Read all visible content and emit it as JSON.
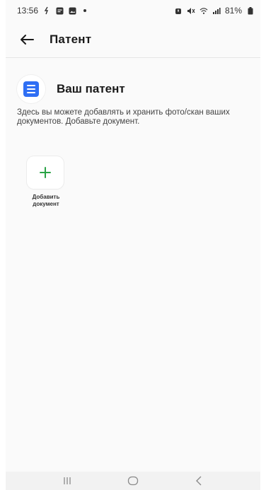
{
  "status_bar": {
    "time": "13:56",
    "battery": "81%",
    "icons": [
      "sync-icon",
      "message-icon",
      "image-icon",
      "dot-icon",
      "alarm-icon",
      "mute-icon",
      "wifi-icon",
      "signal-icon",
      "battery-icon"
    ]
  },
  "header": {
    "back_icon": "arrow-left-icon",
    "title": "Патент"
  },
  "patent": {
    "icon": "document-icon",
    "title": "Ваш патент",
    "description": "Здесь вы можете добавлять и хранить фото/скан ваших документов. Добавьте документ."
  },
  "add_document": {
    "icon": "plus-icon",
    "label": "Добавить\nдокумент"
  },
  "nav_bar": {
    "icons": [
      "recent-apps-icon",
      "home-icon",
      "back-icon"
    ]
  },
  "colors": {
    "accent_blue": "#2f6ff4",
    "plus_green": "#2aa346",
    "background": "#fafafa"
  }
}
